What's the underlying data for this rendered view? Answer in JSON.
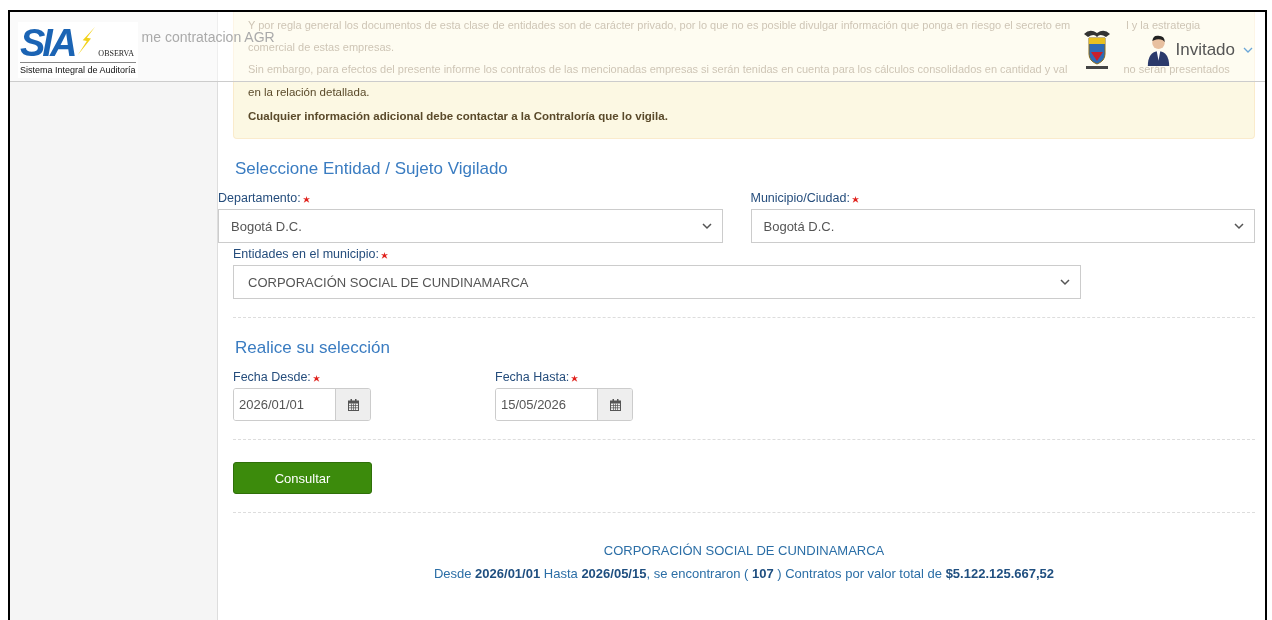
{
  "header": {
    "logo": {
      "wordmark": "SIA",
      "tagline": "OBSERVA",
      "subtitle": "Sistema Integral de Auditoría"
    },
    "title": "me contratacion AGR",
    "user": {
      "name": "Invitado"
    }
  },
  "notice": {
    "faded_lines": [
      {
        "parts": [
          "Y por regla general los documentos de esta clase de entidades son de carácter privado, por lo que no es posible divulgar información que ponga en riesgo el secreto em",
          "l y la estrategia"
        ]
      },
      {
        "parts": [
          "comercial de estas empresas."
        ]
      },
      {
        "parts": [
          "Sin embargo, para efectos del presente informe los contratos de las mencionadas empresas si serán tenidas en cuenta para los cálculos consolidados en cantidad y val",
          "no serán presentados"
        ]
      }
    ],
    "lines": [
      {
        "text": "en la relación detallada.",
        "bold": false
      },
      {
        "text": "Cualquier información adicional debe contactar a la Contraloría que lo vigila.",
        "bold": true
      }
    ]
  },
  "entity_section": {
    "heading": "Seleccione Entidad / Sujeto Vigilado",
    "fields": [
      {
        "label": "Departamento:",
        "required": true,
        "value": "Bogotá D.C."
      },
      {
        "label": "Municipio/Ciudad:",
        "required": true,
        "value": "Bogotá D.C."
      },
      {
        "label": "Entidades en el municipio:",
        "required": true,
        "value": "CORPORACIÓN SOCIAL DE CUNDINAMARCA"
      }
    ]
  },
  "selection_section": {
    "heading": "Realice su selección",
    "dates": [
      {
        "label": "Fecha Desde:",
        "required": true,
        "value": "2026/01/01"
      },
      {
        "label": "Fecha Hasta:",
        "required": true,
        "value": "15/05/2026"
      }
    ],
    "button": "Consultar"
  },
  "result": {
    "entity": "CORPORACIÓN SOCIAL DE CUNDINAMARCA",
    "summary": "Desde **2026/01/01** Hasta **2026/05/15**, se encontraron ( **107** ) Contratos por valor total de **$5.122.125.667,52**"
  }
}
